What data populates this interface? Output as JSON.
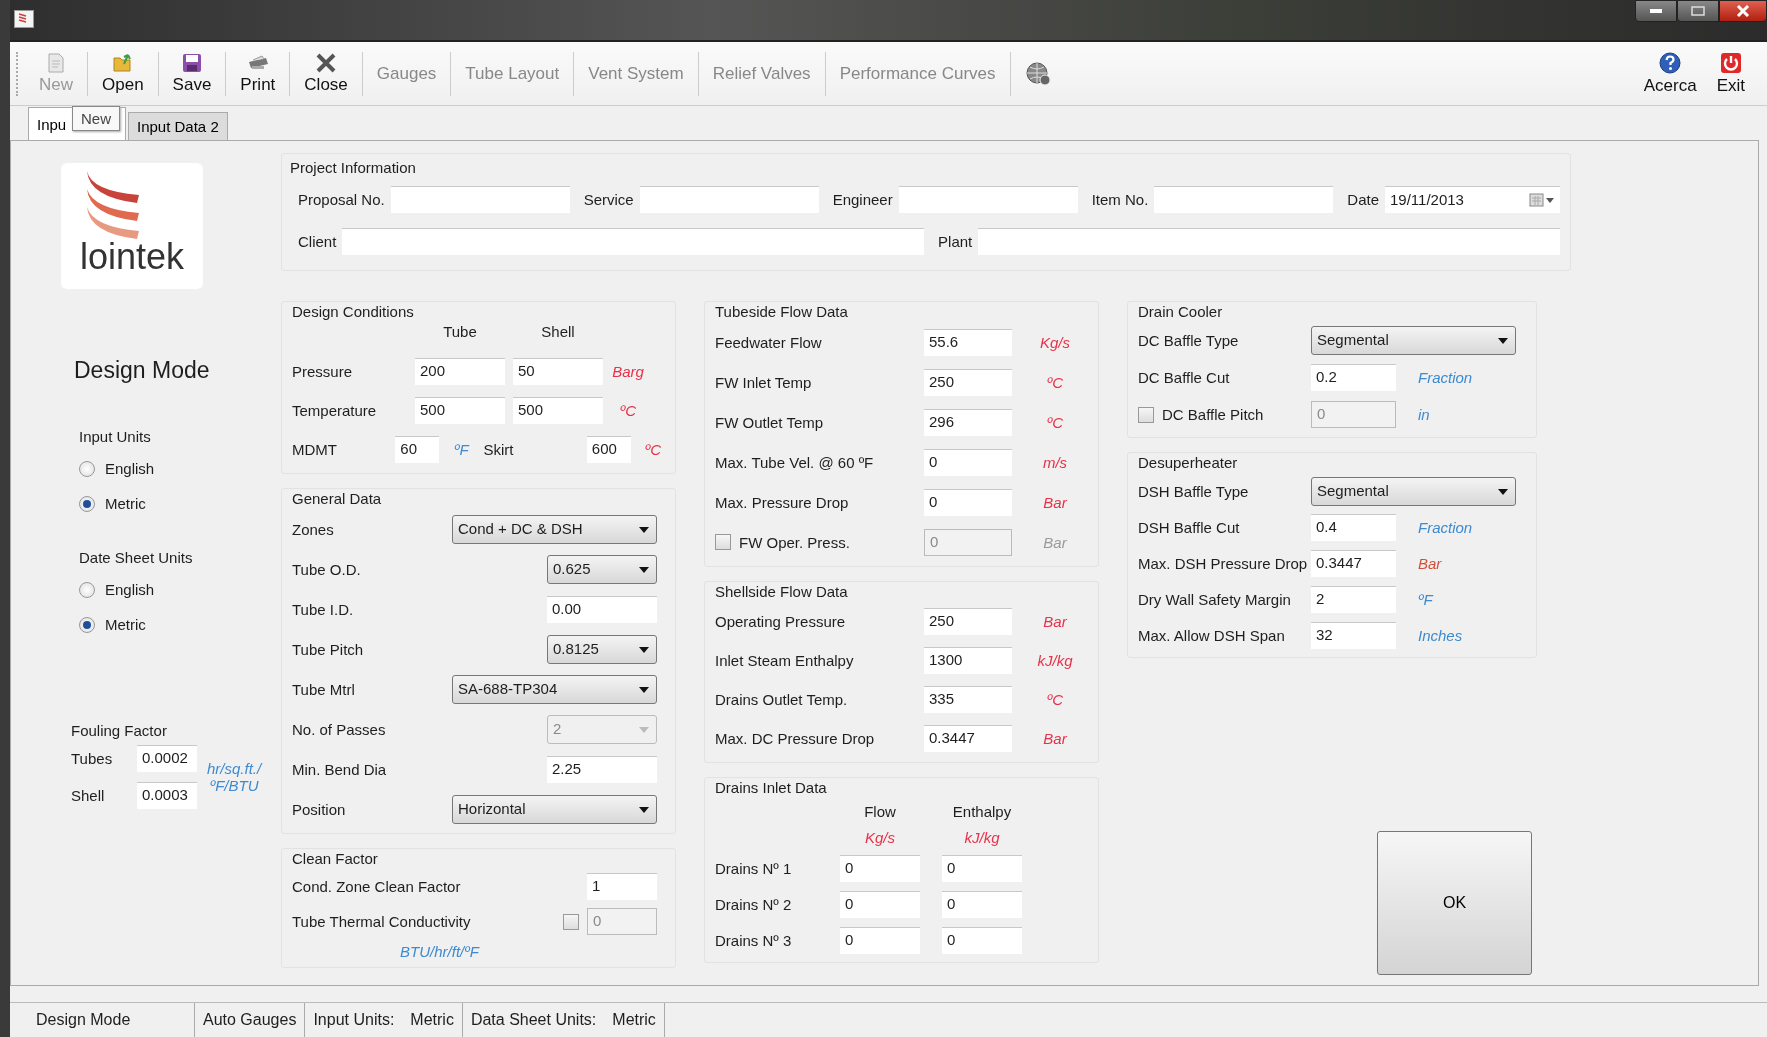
{
  "toolbar": {
    "buttons": [
      {
        "label": "New",
        "disabled": true
      },
      {
        "label": "Open",
        "disabled": false
      },
      {
        "label": "Save",
        "disabled": false
      },
      {
        "label": "Print",
        "disabled": false
      },
      {
        "label": "Close",
        "disabled": false
      }
    ],
    "links": [
      {
        "label": "Gauges",
        "disabled": true
      },
      {
        "label": "Tube Layout",
        "disabled": true
      },
      {
        "label": "Vent System",
        "disabled": true
      },
      {
        "label": "Relief Valves",
        "disabled": true
      },
      {
        "label": "Performance Curves",
        "disabled": true
      }
    ],
    "right_buttons": [
      {
        "label": "Acerca"
      },
      {
        "label": "Exit"
      }
    ]
  },
  "tooltip": "New",
  "tabs": [
    {
      "label": "Inpu",
      "selected": true
    },
    {
      "label": "Input Data 2",
      "selected": false
    }
  ],
  "logo": {
    "text": "lointek"
  },
  "mode_title": "Design Mode",
  "unit_groups": [
    {
      "title": "Input Units",
      "options": [
        {
          "label": "English",
          "selected": false
        },
        {
          "label": "Metric",
          "selected": true
        }
      ]
    },
    {
      "title": "Date Sheet Units",
      "options": [
        {
          "label": "English",
          "selected": false
        },
        {
          "label": "Metric",
          "selected": true
        }
      ]
    }
  ],
  "fouling_factor": {
    "title": "Fouling Factor",
    "rows": [
      {
        "label": "Tubes",
        "value": "0.0002"
      },
      {
        "label": "Shell",
        "value": "0.0003"
      }
    ],
    "unit_lines": [
      "hr/sq.ft./",
      "ºF/BTU"
    ]
  },
  "project_information": {
    "title": "Project Information",
    "rows": [
      {
        "fields": [
          {
            "label": "Proposal No.",
            "kind": "text"
          },
          {
            "label": "Service",
            "kind": "text"
          },
          {
            "label": "Engineer",
            "kind": "text"
          },
          {
            "label": "Item No.",
            "kind": "text"
          },
          {
            "label": "Date",
            "kind": "date",
            "value": "19/11/2013"
          }
        ]
      },
      {
        "fields": [
          {
            "label": "Client",
            "kind": "text"
          },
          {
            "label": "Plant",
            "kind": "text"
          }
        ]
      }
    ]
  },
  "columns": [
    {
      "sections": [
        {
          "title": "Design Conditions",
          "kind": "form",
          "rows": [
            {
              "cells": [
                {
                  "kind": "head",
                  "text": "Tube"
                },
                {
                  "kind": "head",
                  "text": "Shell"
                }
              ]
            },
            {
              "cells": [
                {
                  "kind": "label",
                  "text": "Pressure"
                },
                {
                  "kind": "input",
                  "value": "200",
                  "disabled": false
                },
                {
                  "kind": "input",
                  "value": "50",
                  "disabled": false
                },
                {
                  "kind": "unit",
                  "text": "Barg",
                  "color": "#e8304a"
                }
              ]
            },
            {
              "cells": [
                {
                  "kind": "label",
                  "text": "Temperature"
                },
                {
                  "kind": "input",
                  "value": "500",
                  "disabled": false
                },
                {
                  "kind": "input",
                  "value": "500",
                  "disabled": false
                },
                {
                  "kind": "unit",
                  "text": "ºC",
                  "color": "#e8304a"
                }
              ]
            },
            {
              "cells": [
                {
                  "kind": "label",
                  "text": "MDMT"
                },
                {
                  "kind": "input",
                  "value": "60",
                  "disabled": false
                },
                {
                  "kind": "unit",
                  "text": "ºF",
                  "color": "#3d8ad0"
                },
                {
                  "kind": "label",
                  "text": "Skirt"
                },
                {
                  "kind": "input",
                  "value": "600",
                  "disabled": false
                },
                {
                  "kind": "unit",
                  "text": "ºC",
                  "color": "#e8304a"
                }
              ]
            }
          ]
        },
        {
          "title": "General Data",
          "kind": "form",
          "rows": [
            {
              "cells": [
                {
                  "kind": "label",
                  "text": "Zones"
                },
                {
                  "kind": "combo",
                  "value": "Cond + DC & DSH",
                  "disabled": false
                }
              ]
            },
            {
              "cells": [
                {
                  "kind": "label",
                  "text": "Tube O.D."
                },
                {
                  "kind": "select",
                  "value": "0.625",
                  "disabled": false
                }
              ]
            },
            {
              "cells": [
                {
                  "kind": "label",
                  "text": "Tube I.D."
                },
                {
                  "kind": "input",
                  "value": "0.00",
                  "disabled": false
                }
              ]
            },
            {
              "cells": [
                {
                  "kind": "label",
                  "text": "Tube Pitch"
                },
                {
                  "kind": "select",
                  "value": "0.8125",
                  "disabled": false
                }
              ]
            },
            {
              "cells": [
                {
                  "kind": "label",
                  "text": "Tube Mtrl"
                },
                {
                  "kind": "combo",
                  "value": "SA-688-TP304",
                  "disabled": false
                }
              ]
            },
            {
              "cells": [
                {
                  "kind": "label",
                  "text": "No. of Passes"
                },
                {
                  "kind": "select",
                  "value": "2",
                  "disabled": true
                }
              ]
            },
            {
              "cells": [
                {
                  "kind": "label",
                  "text": "Min. Bend Dia"
                },
                {
                  "kind": "input",
                  "value": "2.25",
                  "disabled": false
                }
              ]
            },
            {
              "cells": [
                {
                  "kind": "label",
                  "text": "Position"
                },
                {
                  "kind": "combo",
                  "value": "Horizontal",
                  "disabled": false
                }
              ]
            }
          ]
        },
        {
          "title": "Clean Factor",
          "kind": "form",
          "rows": [
            {
              "cells": [
                {
                  "kind": "label",
                  "text": "Cond. Zone Clean Factor"
                },
                {
                  "kind": "input",
                  "value": "1",
                  "disabled": false
                }
              ]
            },
            {
              "cells": [
                {
                  "kind": "label",
                  "text": "Tube Thermal Conductivity"
                },
                {
                  "kind": "check",
                  "checked": false
                },
                {
                  "kind": "input",
                  "value": "0",
                  "disabled": true
                }
              ]
            },
            {
              "cells": [
                {
                  "kind": "unit",
                  "text": "BTU/hr/ft/ºF",
                  "color": "#3d8ad0"
                }
              ]
            }
          ]
        }
      ]
    },
    {
      "sections": [
        {
          "title": "Tubeside Flow Data",
          "kind": "form",
          "rows": [
            {
              "cells": [
                {
                  "kind": "label",
                  "text": "Feedwater Flow"
                },
                {
                  "kind": "input",
                  "value": "55.6",
                  "disabled": false
                },
                {
                  "kind": "unit",
                  "text": "Kg/s",
                  "color": "#e8304a"
                }
              ]
            },
            {
              "cells": [
                {
                  "kind": "label",
                  "text": "FW Inlet Temp"
                },
                {
                  "kind": "input",
                  "value": "250",
                  "disabled": false
                },
                {
                  "kind": "unit",
                  "text": "ºC",
                  "color": "#e8304a"
                }
              ]
            },
            {
              "cells": [
                {
                  "kind": "label",
                  "text": "FW Outlet Temp"
                },
                {
                  "kind": "input",
                  "value": "296",
                  "disabled": false
                },
                {
                  "kind": "unit",
                  "text": "ºC",
                  "color": "#e8304a"
                }
              ]
            },
            {
              "cells": [
                {
                  "kind": "label",
                  "text": "Max. Tube Vel. @ 60 ºF"
                },
                {
                  "kind": "input",
                  "value": "0",
                  "disabled": false
                },
                {
                  "kind": "unit",
                  "text": "m/s",
                  "color": "#e8304a"
                }
              ]
            },
            {
              "cells": [
                {
                  "kind": "label",
                  "text": "Max. Pressure Drop"
                },
                {
                  "kind": "input",
                  "value": "0",
                  "disabled": false
                },
                {
                  "kind": "unit",
                  "text": "Bar",
                  "color": "#e8304a"
                }
              ]
            },
            {
              "cells": [
                {
                  "kind": "check",
                  "text": "FW Oper. Press.",
                  "checked": false
                },
                {
                  "kind": "input",
                  "value": "0",
                  "disabled": true
                },
                {
                  "kind": "unit",
                  "text": "Bar",
                  "color": "#9a9a9a"
                }
              ]
            }
          ]
        },
        {
          "title": "Shellside Flow Data",
          "kind": "form",
          "rows": [
            {
              "cells": [
                {
                  "kind": "label",
                  "text": "Operating Pressure"
                },
                {
                  "kind": "input",
                  "value": "250",
                  "disabled": false
                },
                {
                  "kind": "unit",
                  "text": "Bar",
                  "color": "#e8304a"
                }
              ]
            },
            {
              "cells": [
                {
                  "kind": "label",
                  "text": "Inlet Steam Enthalpy"
                },
                {
                  "kind": "input",
                  "value": "1300",
                  "disabled": false
                },
                {
                  "kind": "unit",
                  "text": "kJ/kg",
                  "color": "#e8304a"
                }
              ]
            },
            {
              "cells": [
                {
                  "kind": "label",
                  "text": "Drains Outlet Temp."
                },
                {
                  "kind": "input",
                  "value": "335",
                  "disabled": false
                },
                {
                  "kind": "unit",
                  "text": "ºC",
                  "color": "#e8304a"
                }
              ]
            },
            {
              "cells": [
                {
                  "kind": "label",
                  "text": "Max. DC Pressure Drop"
                },
                {
                  "kind": "input",
                  "value": "0.3447",
                  "disabled": false
                },
                {
                  "kind": "unit",
                  "text": "Bar",
                  "color": "#e8304a"
                }
              ]
            }
          ]
        },
        {
          "title": "Drains Inlet Data",
          "kind": "table",
          "rows": [
            {
              "cells": [
                {
                  "kind": "head",
                  "text": "Flow"
                },
                {
                  "kind": "head",
                  "text": "Enthalpy"
                }
              ]
            },
            {
              "cells": [
                {
                  "kind": "unit",
                  "text": "Kg/s",
                  "color": "#e8304a"
                },
                {
                  "kind": "unit",
                  "text": "kJ/kg",
                  "color": "#e8304a"
                }
              ]
            },
            {
              "cells": [
                {
                  "kind": "label",
                  "text": "Drains Nº 1"
                },
                {
                  "kind": "input",
                  "value": "0",
                  "disabled": false
                },
                {
                  "kind": "input",
                  "value": "0",
                  "disabled": false
                }
              ]
            },
            {
              "cells": [
                {
                  "kind": "label",
                  "text": "Drains Nº 2"
                },
                {
                  "kind": "input",
                  "value": "0",
                  "disabled": false
                },
                {
                  "kind": "input",
                  "value": "0",
                  "disabled": false
                }
              ]
            },
            {
              "cells": [
                {
                  "kind": "label",
                  "text": "Drains Nº 3"
                },
                {
                  "kind": "input",
                  "value": "0",
                  "disabled": false
                },
                {
                  "kind": "input",
                  "value": "0",
                  "disabled": false
                }
              ]
            }
          ]
        }
      ]
    },
    {
      "sections": [
        {
          "title": "Drain Cooler",
          "kind": "form",
          "rows": [
            {
              "cells": [
                {
                  "kind": "label",
                  "text": "DC Baffle Type"
                },
                {
                  "kind": "combo",
                  "value": "Segmental",
                  "disabled": false
                }
              ]
            },
            {
              "cells": [
                {
                  "kind": "label",
                  "text": "DC Baffle Cut"
                },
                {
                  "kind": "input",
                  "value": "0.2",
                  "disabled": false
                },
                {
                  "kind": "unit",
                  "text": "Fraction",
                  "color": "#3d8ad0"
                }
              ]
            },
            {
              "cells": [
                {
                  "kind": "check",
                  "text": "DC Baffle Pitch",
                  "checked": false
                },
                {
                  "kind": "input",
                  "value": "0",
                  "disabled": true
                },
                {
                  "kind": "unit",
                  "text": "in",
                  "color": "#3d8ad0"
                }
              ]
            }
          ]
        },
        {
          "title": "Desuperheater",
          "kind": "form",
          "rows": [
            {
              "cells": [
                {
                  "kind": "label",
                  "text": "DSH Baffle Type"
                },
                {
                  "kind": "combo",
                  "value": "Segmental",
                  "disabled": false
                }
              ]
            },
            {
              "cells": [
                {
                  "kind": "label",
                  "text": "DSH Baffle Cut"
                },
                {
                  "kind": "input",
                  "value": "0.4",
                  "disabled": false
                },
                {
                  "kind": "unit",
                  "text": "Fraction",
                  "color": "#3d8ad0"
                }
              ]
            },
            {
              "cells": [
                {
                  "kind": "label",
                  "text": "Max. DSH Pressure Drop"
                },
                {
                  "kind": "input",
                  "value": "0.3447",
                  "disabled": false
                },
                {
                  "kind": "unit",
                  "text": "Bar",
                  "color": "#d0503c"
                }
              ]
            },
            {
              "cells": [
                {
                  "kind": "label",
                  "text": "Dry Wall Safety Margin"
                },
                {
                  "kind": "input",
                  "value": "2",
                  "disabled": false
                },
                {
                  "kind": "unit",
                  "text": "ºF",
                  "color": "#3d8ad0"
                }
              ]
            },
            {
              "cells": [
                {
                  "kind": "label",
                  "text": "Max. Allow DSH Span"
                },
                {
                  "kind": "input",
                  "value": "32",
                  "disabled": false
                },
                {
                  "kind": "unit",
                  "text": "Inches",
                  "color": "#3d8ad0"
                }
              ]
            }
          ]
        }
      ]
    }
  ],
  "ok_button": "OK",
  "status_bar": [
    {
      "label": "Design Mode"
    },
    {
      "label": "Auto Gauges"
    },
    {
      "label": "Input Units:",
      "value": "Metric"
    },
    {
      "label": "Data Sheet Units:",
      "value": "Metric"
    }
  ]
}
